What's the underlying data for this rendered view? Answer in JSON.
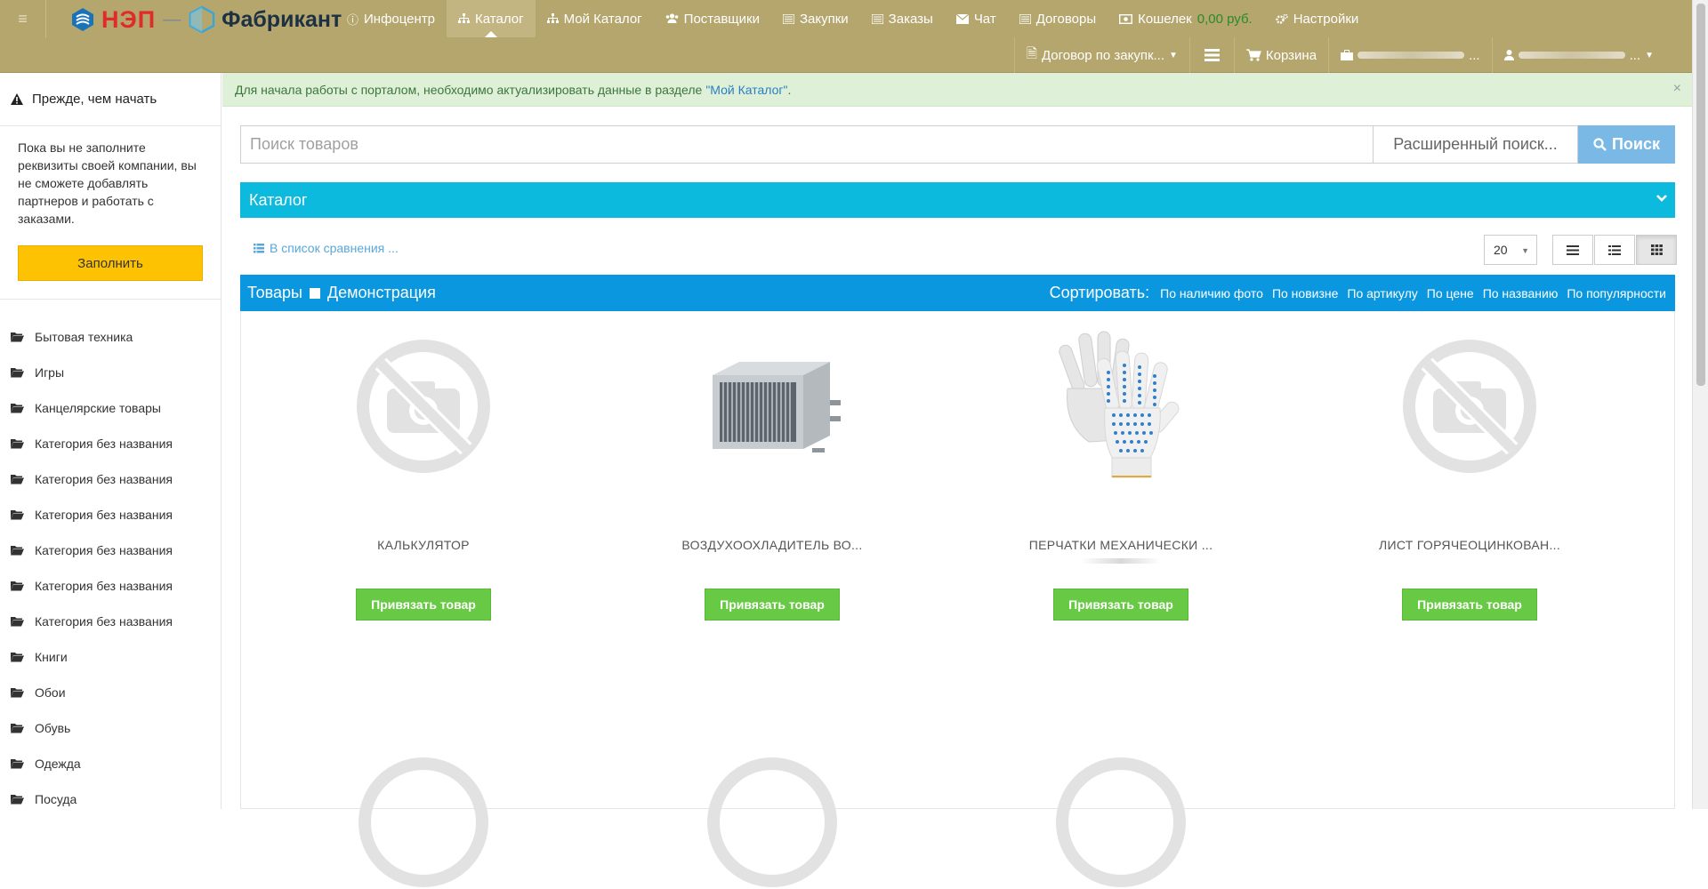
{
  "header": {
    "logo_nep": "НЭП",
    "logo_fabrikant": "Фабрикант",
    "nav": [
      {
        "label": "Инфоцентр",
        "icon": "info-circle-icon"
      },
      {
        "label": "Каталог",
        "icon": "sitemap-icon",
        "active": true
      },
      {
        "label": "Мой Каталог",
        "icon": "sitemap-icon"
      },
      {
        "label": "Поставщики",
        "icon": "users-icon"
      },
      {
        "label": "Закупки",
        "icon": "list-icon"
      },
      {
        "label": "Заказы",
        "icon": "list-alt-icon"
      },
      {
        "label": "Чат",
        "icon": "envelope-icon"
      },
      {
        "label": "Договоры",
        "icon": "list-icon"
      },
      {
        "label": "Кошелек",
        "icon": "money-icon",
        "extra": "0,00 руб."
      },
      {
        "label": "Настройки",
        "icon": "cogs-icon"
      }
    ],
    "nav2": {
      "contract": "Договор по закупк...",
      "list_icon": "list-icon",
      "cart": "Корзина",
      "company_suffix": "...",
      "user_suffix": "..."
    }
  },
  "sidebar": {
    "warning_title": "Прежде, чем начать",
    "warning_text": "Пока вы не заполните реквизиты своей компании, вы не сможете добавлять партнеров и работать с заказами.",
    "fill_button": "Заполнить",
    "categories": [
      "Бытовая техника",
      "Игры",
      "Канцелярские товары",
      "Категория без названия",
      "Категория без названия",
      "Категория без названия",
      "Категория без названия",
      "Категория без названия",
      "Категория без названия",
      "Книги",
      "Обои",
      "Обувь",
      "Одежда",
      "Посуда"
    ]
  },
  "alert": {
    "text": "Для начала работы с порталом, необходимо актуализировать данные в разделе",
    "link": "\"Мой Каталог\"",
    "end": ".",
    "close": "×"
  },
  "search": {
    "placeholder": "Поиск товаров",
    "advanced": "Расширенный поиск...",
    "button": "Поиск"
  },
  "catalog_bar": {
    "label": "Каталог"
  },
  "toolbar": {
    "compare": "В список сравнения ...",
    "per_page": "20"
  },
  "goods_bar": {
    "title": "Товары",
    "demo": "Демонстрация",
    "sort_label": "Сортировать:",
    "sort_options": [
      "По наличию фото",
      "По новизне",
      "По артикулу",
      "По цене",
      "По названию",
      "По популярности"
    ]
  },
  "products": [
    {
      "name": "КАЛЬКУЛЯТОР",
      "image": "no-photo-icon",
      "button": "Привязать товар"
    },
    {
      "name": "ВОЗДУХООХЛАДИТЕЛЬ ВО...",
      "image": "air-cooler-image",
      "button": "Привязать товар"
    },
    {
      "name": "ПЕРЧАТКИ МЕХАНИЧЕСКИ ...",
      "image": "gloves-image",
      "button": "Привязать товар"
    },
    {
      "name": "ЛИСТ ГОРЯЧЕОЦИНКОВАН...",
      "image": "no-photo-icon",
      "button": "Привязать товар"
    }
  ],
  "colors": {
    "header": "#b5a66d",
    "catalog_bar": "#0bbadd",
    "goods_bar": "#0a97e0",
    "bind_button": "#68c945",
    "fill_button": "#fdc302",
    "search_button": "#7ab8e6",
    "alert_bg": "#dff0d8"
  }
}
